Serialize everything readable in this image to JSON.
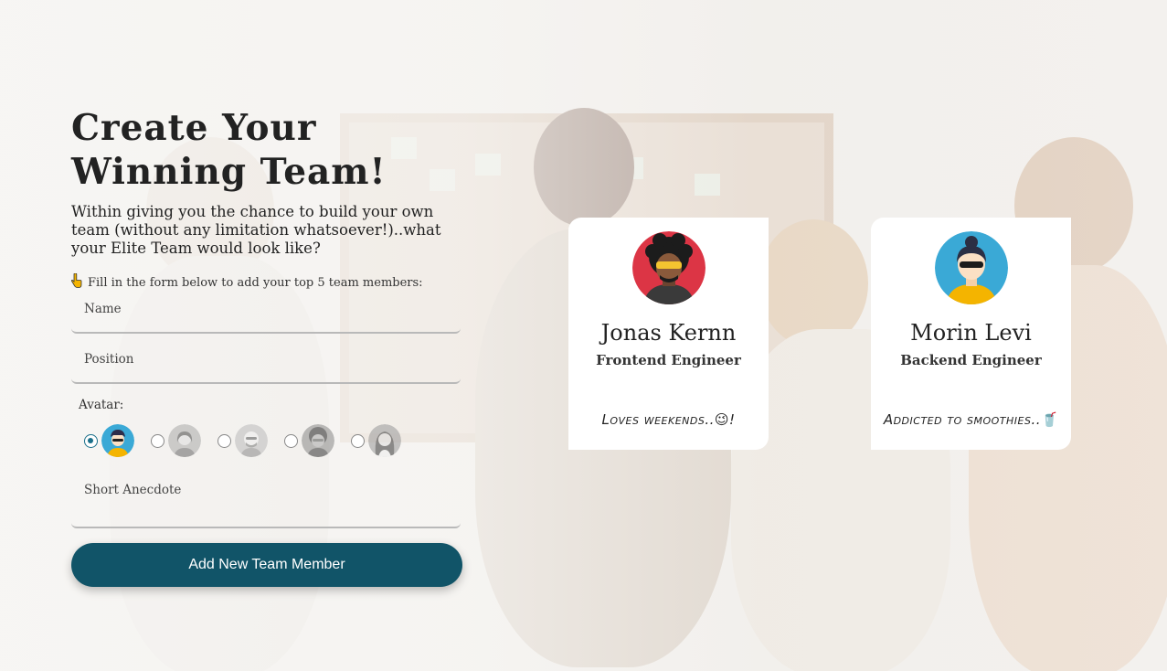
{
  "page": {
    "title": "Create Your Winning Team!",
    "lead": "Within giving you the chance to build your own team (without any limitation whatsoever!)..what your Elite Team would look like?",
    "hint": "Fill in the form below to add your top 5 team members:"
  },
  "form": {
    "name_placeholder": "Name",
    "position_placeholder": "Position",
    "avatar_label": "Avatar:",
    "avatars": [
      {
        "icon": "avatar-woman-cap-icon",
        "selected": true
      },
      {
        "icon": "avatar-woman-icon",
        "selected": false
      },
      {
        "icon": "avatar-bald-man-icon",
        "selected": false
      },
      {
        "icon": "avatar-curly-man-icon",
        "selected": false
      },
      {
        "icon": "avatar-long-hair-icon",
        "selected": false
      }
    ],
    "anecdote_placeholder": "Short Anecdote",
    "submit_label": "Add New Team Member"
  },
  "members": [
    {
      "name": "Jonas Kernn",
      "position": "Frontend Engineer",
      "anecdote": "Loves weekends..",
      "anecdote_emoji": "😉",
      "anecdote_suffix": "!",
      "avatar_icon": "avatar-curly-man-icon",
      "avatar_bg": "#dc3545"
    },
    {
      "name": "Morin Levi",
      "position": "Backend Engineer",
      "anecdote": "Addicted to smoothies..",
      "anecdote_emoji": "🥤",
      "anecdote_suffix": "",
      "avatar_icon": "avatar-woman-bun-icon",
      "avatar_bg": "#3aa9d6"
    }
  ],
  "colors": {
    "button": "#115468",
    "radio_checked": "#1a6f8a"
  }
}
